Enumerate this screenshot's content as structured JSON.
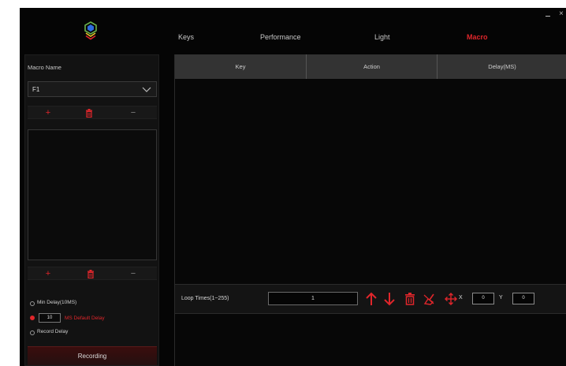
{
  "window": {
    "minimize_glyph": "—",
    "close_glyph": "×"
  },
  "tabs": [
    {
      "label": "Keys",
      "active": false
    },
    {
      "label": "Performance",
      "active": false
    },
    {
      "label": "Light",
      "active": false
    },
    {
      "label": "Macro",
      "active": true
    }
  ],
  "sidebar": {
    "macro_name_label": "Macro Name",
    "selected_macro": "F1",
    "top_tools": {
      "add": "+",
      "delete_icon": "trash-icon",
      "remove": "−"
    },
    "bottom_tools": {
      "add": "+",
      "delete_icon": "trash-icon",
      "remove": "−"
    },
    "delay_options": [
      {
        "label": "Min Delay(10MS)",
        "selected": false
      },
      {
        "label": "MS Default Delay",
        "selected": true,
        "value": "10"
      },
      {
        "label": "Record Delay",
        "selected": false
      }
    ],
    "record_button_label": "Recording"
  },
  "table": {
    "columns": [
      "Key",
      "Action",
      "Delay(MS)"
    ],
    "rows": []
  },
  "loop": {
    "label": "Loop Times(1~255)",
    "value": "1"
  },
  "actions": [
    "arrow-up-icon",
    "arrow-down-icon",
    "trash-icon",
    "clear-icon",
    "move-icon"
  ],
  "coords": {
    "x_label": "X",
    "x_value": "0",
    "y_label": "Y",
    "y_value": "0"
  },
  "colors": {
    "accent": "#e0262b",
    "background": "#050505",
    "panel": "#121212",
    "header": "#333333"
  }
}
